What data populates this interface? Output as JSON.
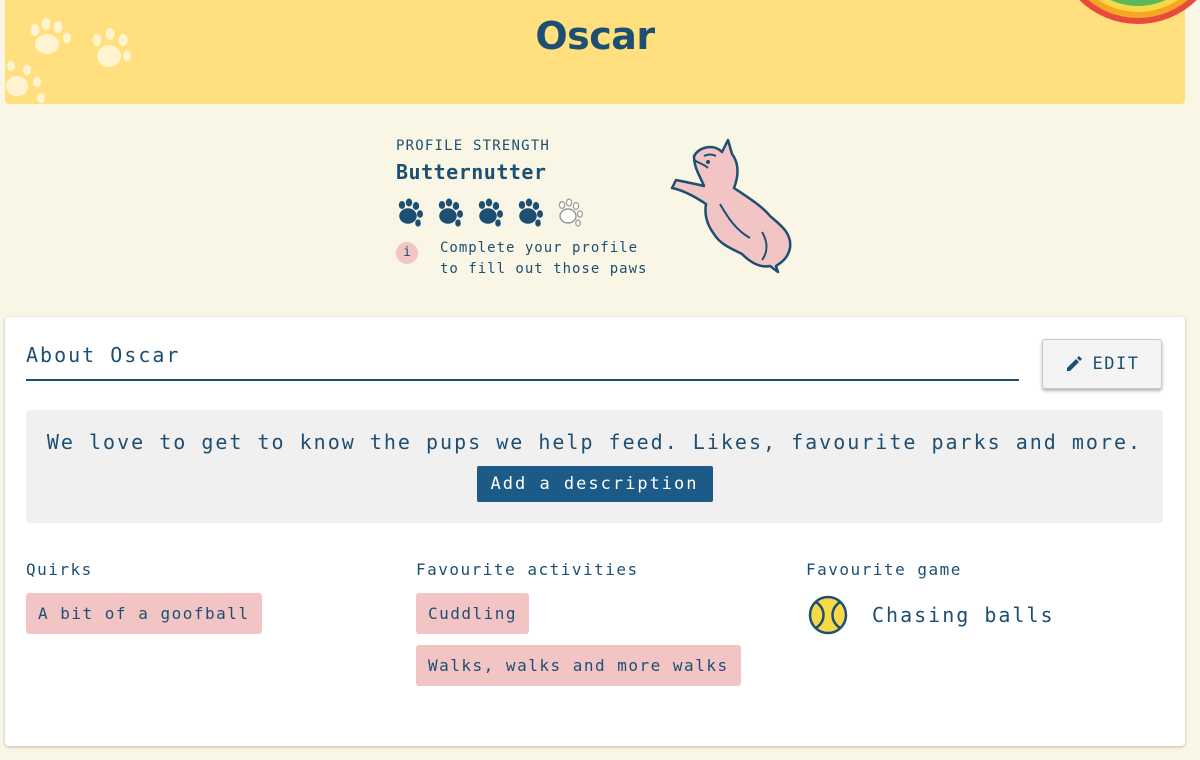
{
  "header": {
    "title": "Oscar"
  },
  "profile": {
    "strength_label": "PROFILE STRENGTH",
    "strength_name": "Butternutter",
    "paws_filled": 4,
    "paws_total": 5,
    "info_icon": "i",
    "info_line1": "Complete your profile",
    "info_line2": "to fill out those paws"
  },
  "about": {
    "title": "About Oscar",
    "edit_label": "EDIT",
    "description_prompt": "We love to get to know the pups we help feed. Likes, favourite parks and more.",
    "add_description_label": "Add a description"
  },
  "quirks": {
    "label": "Quirks",
    "items": [
      "A bit of a goofball"
    ]
  },
  "activities": {
    "label": "Favourite activities",
    "items": [
      "Cuddling",
      "Walks, walks and more walks"
    ]
  },
  "game": {
    "label": "Favourite game",
    "value": "Chasing balls",
    "icon": "tennis-ball-icon"
  },
  "colors": {
    "navy": "#1d4f73",
    "header": "#ffdf7e",
    "chip": "#f2c4c4",
    "button": "#1c5a87",
    "background": "#faf6e6"
  }
}
